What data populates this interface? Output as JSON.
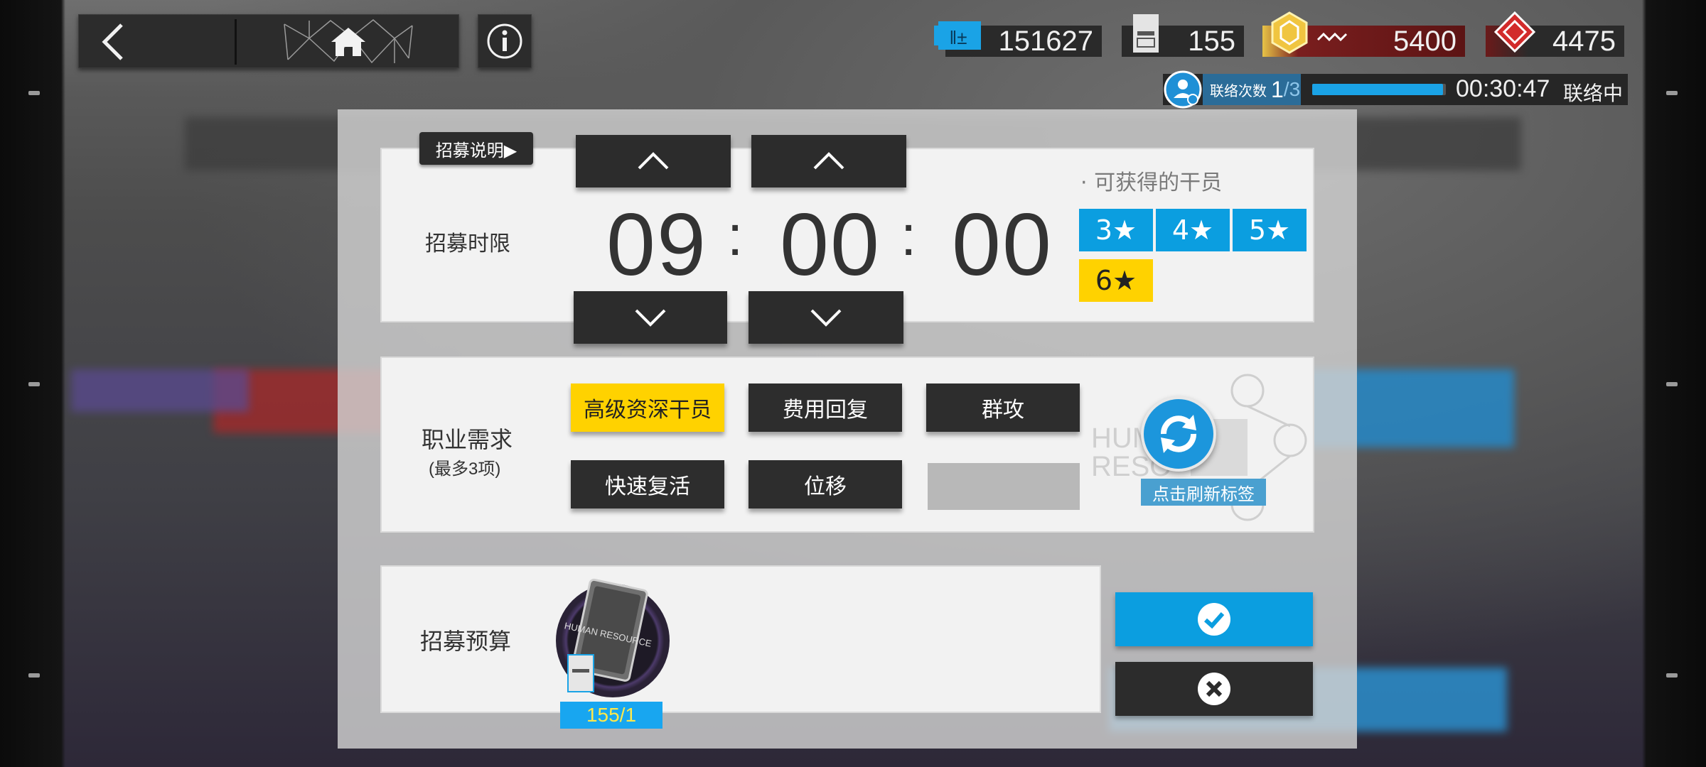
{
  "nav": {
    "back_icon": "chevron-left-icon",
    "home_icon": "home-icon",
    "info_icon": "info-icon"
  },
  "currency": [
    {
      "name": "recruitment-permit",
      "icon": "ticket-icon",
      "color": "#1aa3e6",
      "value": "151627"
    },
    {
      "name": "headhunting-permit",
      "icon": "permit-card-icon",
      "color": "#d8d8d8",
      "value": "155"
    },
    {
      "name": "orundum",
      "icon": "orundum-icon",
      "color": "#e8b92a",
      "value": "5400"
    },
    {
      "name": "originite-prime",
      "icon": "originite-icon",
      "color": "#d02a2a",
      "value": "4475"
    }
  ],
  "network": {
    "label": "联络次数",
    "count": "1",
    "total": "/3",
    "progress": 0.98,
    "time": "00:30:47",
    "status": "联络中"
  },
  "timer": {
    "section_label": "招募时限",
    "help_button": "招募说明▶",
    "hours": "09",
    "minutes": "00",
    "seconds": "00",
    "separator": ":"
  },
  "obtainable": {
    "title": "· 可获得的干员",
    "stars": [
      "3★",
      "4★",
      "5★",
      "6★"
    ],
    "colors": {
      "normal": "#0b9ee0",
      "top": "#ffd200"
    }
  },
  "tags": {
    "section_label": "职业需求",
    "section_sub": "(最多3项)",
    "items": [
      "高级资深干员",
      "费用回复",
      "群攻",
      "快速复活",
      "位移"
    ],
    "selected_color": "#ffd200",
    "refresh_label": "点击刷新标签"
  },
  "budget": {
    "section_label": "招募预算",
    "count": "155/1",
    "card_text": "HUMAN RESOURCE"
  },
  "actions": {
    "confirm_icon": "check-icon",
    "cancel_icon": "close-icon",
    "confirm_color": "#0b9ee0"
  }
}
